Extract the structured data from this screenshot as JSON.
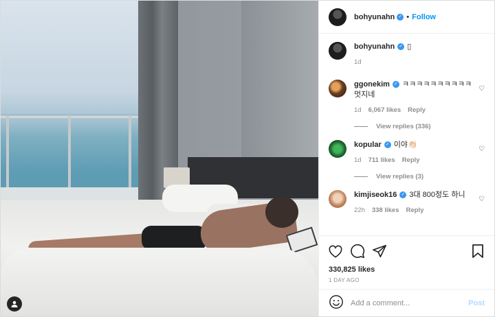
{
  "header": {
    "username": "bohyunahn",
    "follow_label": "Follow",
    "dot": "•"
  },
  "caption": {
    "username": "bohyunahn",
    "text": "▯",
    "time": "1d"
  },
  "comments": [
    {
      "username": "ggonekim",
      "text": "ㅋㅋㅋㅋㅋㅋㅋㅋㅋㅋ 멋지네",
      "time": "1d",
      "likes": "6,067 likes",
      "reply_label": "Reply",
      "view_replies": "View replies (336)"
    },
    {
      "username": "kopular",
      "text": "이야👏🏻",
      "time": "1d",
      "likes": "711 likes",
      "reply_label": "Reply",
      "view_replies": "View replies (3)"
    },
    {
      "username": "kimjiseok16",
      "text": "3대 800정도 하니",
      "time": "22h",
      "likes": "338 likes",
      "reply_label": "Reply"
    }
  ],
  "stats": {
    "likes": "330,825 likes",
    "time_ago": "1 DAY AGO"
  },
  "add_comment": {
    "placeholder": "Add a comment...",
    "post_label": "Post"
  },
  "icons": {
    "verified": "verified-badge-icon",
    "like": "heart-icon",
    "comment": "comment-icon",
    "share": "share-icon",
    "save": "bookmark-icon",
    "emoji": "emoji-icon",
    "user_tag": "user-tag-icon"
  },
  "colors": {
    "link_blue": "#0095f6",
    "verified_blue": "#3897f0",
    "muted": "#8e8e8e",
    "post_disabled": "#b3dbff"
  }
}
